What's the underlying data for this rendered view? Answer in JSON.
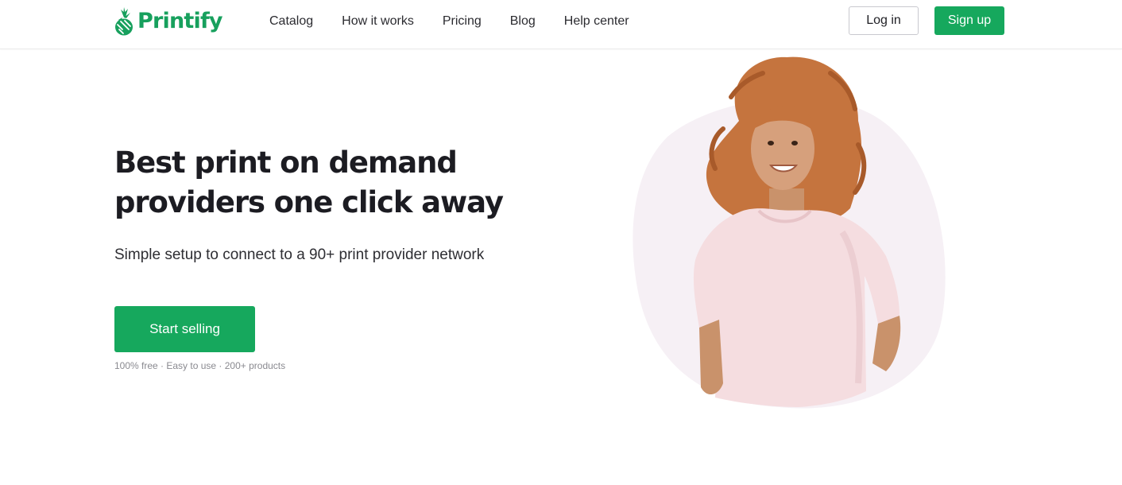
{
  "brand": {
    "name": "Printify",
    "logo_icon": "pineapple-icon",
    "color": "#16a85d"
  },
  "nav": {
    "items": [
      {
        "label": "Catalog"
      },
      {
        "label": "How it works"
      },
      {
        "label": "Pricing"
      },
      {
        "label": "Blog"
      },
      {
        "label": "Help center"
      }
    ]
  },
  "auth": {
    "login_label": "Log in",
    "signup_label": "Sign up"
  },
  "hero": {
    "title": "Best print on demand providers one click away",
    "subtitle": "Simple setup to connect to a 90+ print provider network",
    "cta_label": "Start selling",
    "features": "100% free · Easy to use  · 200+ products",
    "image": "woman-in-pink-tshirt"
  },
  "colors": {
    "accent": "#16a85d",
    "text": "#1c1c22",
    "muted": "#8a8a90",
    "blob": "#f6f0f5"
  }
}
